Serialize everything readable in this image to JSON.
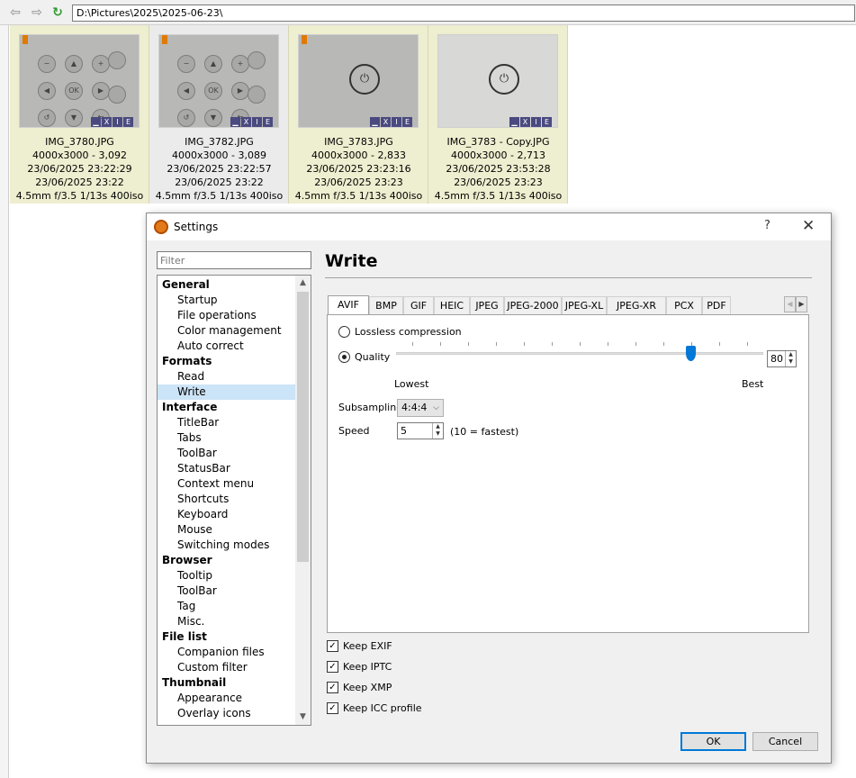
{
  "browser": {
    "path": "D:\\Pictures\\2025\\2025-06-23\\",
    "thumbnails": [
      {
        "name": "IMG_3780.JPG",
        "dims": "4000x3000 - 3,092",
        "date1": "23/06/2025 23:22:29",
        "date2": "23/06/2025 23:22",
        "exif": "4.5mm f/3.5 1/13s 400iso"
      },
      {
        "name": "IMG_3782.JPG",
        "dims": "4000x3000 - 3,089",
        "date1": "23/06/2025 23:22:57",
        "date2": "23/06/2025 23:22",
        "exif": "4.5mm f/3.5 1/13s 400iso"
      },
      {
        "name": "IMG_3783.JPG",
        "dims": "4000x3000 - 2,833",
        "date1": "23/06/2025 23:23:16",
        "date2": "23/06/2025 23:23",
        "exif": "4.5mm f/3.5 1/13s 400iso"
      },
      {
        "name": "IMG_3783 - Copy.JPG",
        "dims": "4000x3000 - 2,713",
        "date1": "23/06/2025 23:53:28",
        "date2": "23/06/2025 23:23",
        "exif": "4.5mm f/3.5 1/13s 400iso"
      }
    ],
    "badges": [
      "▁",
      "X",
      "I",
      "E"
    ],
    "remote_keys": [
      "−",
      "▲",
      "+",
      "◀",
      "OK",
      "▶",
      "↺",
      "▼",
      "⇆"
    ],
    "power_glyph": "⏻"
  },
  "dialog": {
    "title": "Settings",
    "help": "?",
    "close": "✕",
    "filter_placeholder": "Filter",
    "tree": [
      {
        "label": "General",
        "cat": true
      },
      {
        "label": "Startup"
      },
      {
        "label": "File operations"
      },
      {
        "label": "Color management"
      },
      {
        "label": "Auto correct"
      },
      {
        "label": "Formats",
        "cat": true
      },
      {
        "label": "Read"
      },
      {
        "label": "Write",
        "selected": true
      },
      {
        "label": "Interface",
        "cat": true
      },
      {
        "label": "TitleBar"
      },
      {
        "label": "Tabs"
      },
      {
        "label": "ToolBar"
      },
      {
        "label": "StatusBar"
      },
      {
        "label": "Context menu"
      },
      {
        "label": "Shortcuts"
      },
      {
        "label": "Keyboard"
      },
      {
        "label": "Mouse"
      },
      {
        "label": "Switching modes"
      },
      {
        "label": "Browser",
        "cat": true
      },
      {
        "label": "Tooltip"
      },
      {
        "label": "ToolBar"
      },
      {
        "label": "Tag"
      },
      {
        "label": "Misc."
      },
      {
        "label": "File list",
        "cat": true
      },
      {
        "label": "Companion files"
      },
      {
        "label": "Custom filter"
      },
      {
        "label": "Thumbnail",
        "cat": true
      },
      {
        "label": "Appearance"
      },
      {
        "label": "Overlay icons"
      }
    ],
    "page_title": "Write",
    "tabs": [
      "AVIF",
      "BMP",
      "GIF",
      "HEIC",
      "JPEG",
      "JPEG-2000",
      "JPEG-XL",
      "JPEG-XR",
      "PCX",
      "PDF"
    ],
    "active_tab": "AVIF",
    "lossless_label": "Lossless compression",
    "quality_label": "Quality",
    "quality_value": 80,
    "scale_low": "Lowest",
    "scale_high": "Best",
    "subsampling_label": "Subsampling",
    "subsampling_value": "4:4:4",
    "speed_label": "Speed",
    "speed_value": "5",
    "speed_hint": "(10 = fastest)",
    "checks": [
      "Keep EXIF",
      "Keep IPTC",
      "Keep XMP",
      "Keep ICC profile"
    ],
    "ok": "OK",
    "cancel": "Cancel"
  }
}
